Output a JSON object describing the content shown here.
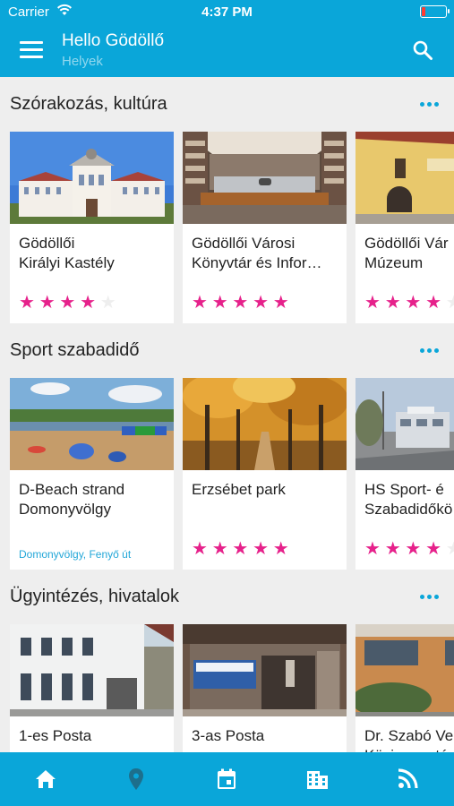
{
  "status_bar": {
    "carrier": "Carrier",
    "time": "4:37 PM"
  },
  "header": {
    "title": "Hello Gödöllő",
    "subtitle": "Helyek"
  },
  "sections": [
    {
      "title": "Szórakozás, kultúra",
      "cards": [
        {
          "name": "Gödöllői\nKirályi Kastély",
          "rating": 4,
          "image": "palace"
        },
        {
          "name": "Gödöllői Városi Könyvtár és Infor…",
          "rating": 5,
          "image": "library"
        },
        {
          "name": "Gödöllői Vár\nMúzeum",
          "rating": 4,
          "image": "museum"
        }
      ]
    },
    {
      "title": "Sport szabadidő",
      "cards": [
        {
          "name": "D-Beach strand Domonyvölgy",
          "location": "Domonyvölgy, Fenyő út",
          "image": "beach"
        },
        {
          "name": "Erzsébet park",
          "rating": 5,
          "image": "park"
        },
        {
          "name": "HS Sport- é\nSzabadidőkö",
          "rating": 4,
          "image": "sport"
        }
      ]
    },
    {
      "title": "Ügyintézés, hivatalok",
      "cards": [
        {
          "name": "1-es Posta",
          "image": "post1"
        },
        {
          "name": "3-as Posta",
          "image": "post3"
        },
        {
          "name": "Dr. Szabó Ve\nKözigazgatá",
          "image": "office"
        }
      ]
    }
  ],
  "tabs": [
    {
      "icon": "home-icon"
    },
    {
      "icon": "location-pin-icon"
    },
    {
      "icon": "calendar-icon"
    },
    {
      "icon": "building-icon"
    },
    {
      "icon": "rss-feed-icon"
    }
  ],
  "colors": {
    "header": "#0aa6d9",
    "star": "#e6218b",
    "link": "#23a7d8",
    "background": "#eeeeee"
  }
}
